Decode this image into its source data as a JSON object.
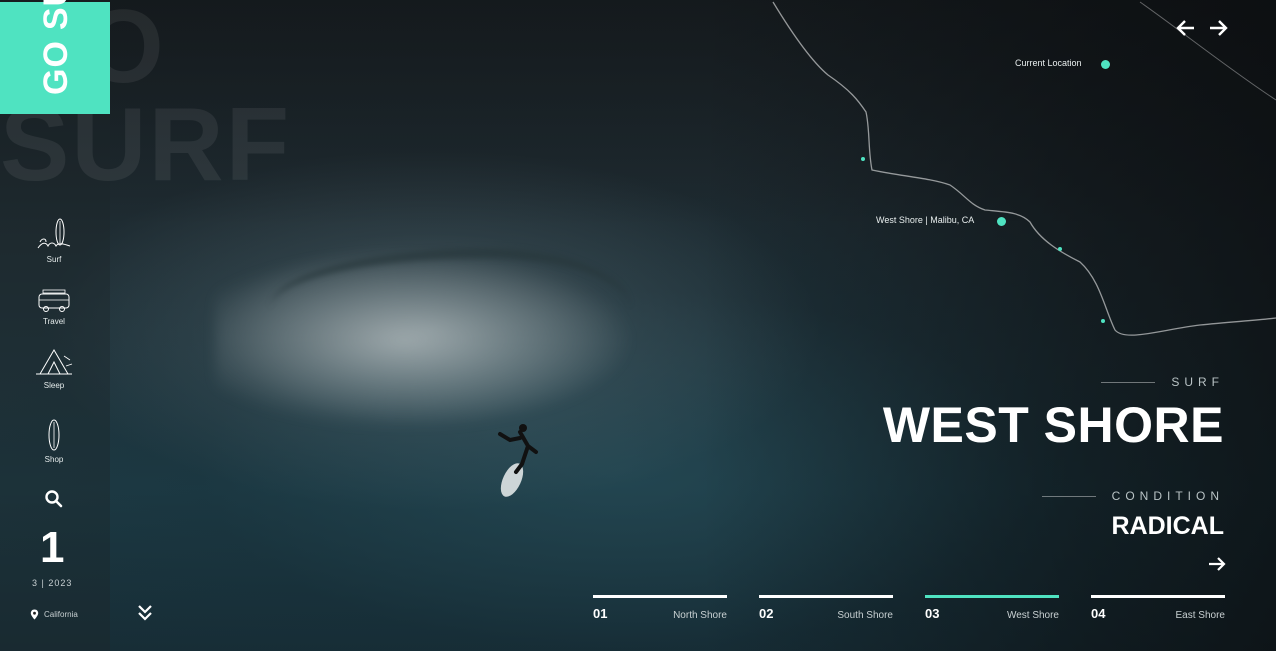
{
  "brand": {
    "word1": "GO",
    "word2": "SURF",
    "ghost": "GO SURF"
  },
  "sidebar": {
    "items": [
      {
        "label": "Surf",
        "icon": "surf-icon"
      },
      {
        "label": "Travel",
        "icon": "van-icon"
      },
      {
        "label": "Sleep",
        "icon": "tent-icon"
      },
      {
        "label": "Shop",
        "icon": "surfboard-icon"
      }
    ],
    "search_icon": "search-icon",
    "slide_number": "1",
    "date": "3  |  2023",
    "location": "California"
  },
  "map": {
    "current_location": "Current Location",
    "spot_label": "West Shore  |  Malibu, CA"
  },
  "hero": {
    "kicker": "SURF",
    "title": "WEST SHORE",
    "condition_kicker": "CONDITION",
    "condition": "RADICAL"
  },
  "tabs": [
    {
      "num": "01",
      "name": "North Shore",
      "active": false
    },
    {
      "num": "02",
      "name": "South Shore",
      "active": false
    },
    {
      "num": "03",
      "name": "West Shore",
      "active": true
    },
    {
      "num": "04",
      "name": "East Shore",
      "active": false
    }
  ],
  "colors": {
    "accent": "#4fe3c1",
    "background": "#1e2a30"
  }
}
